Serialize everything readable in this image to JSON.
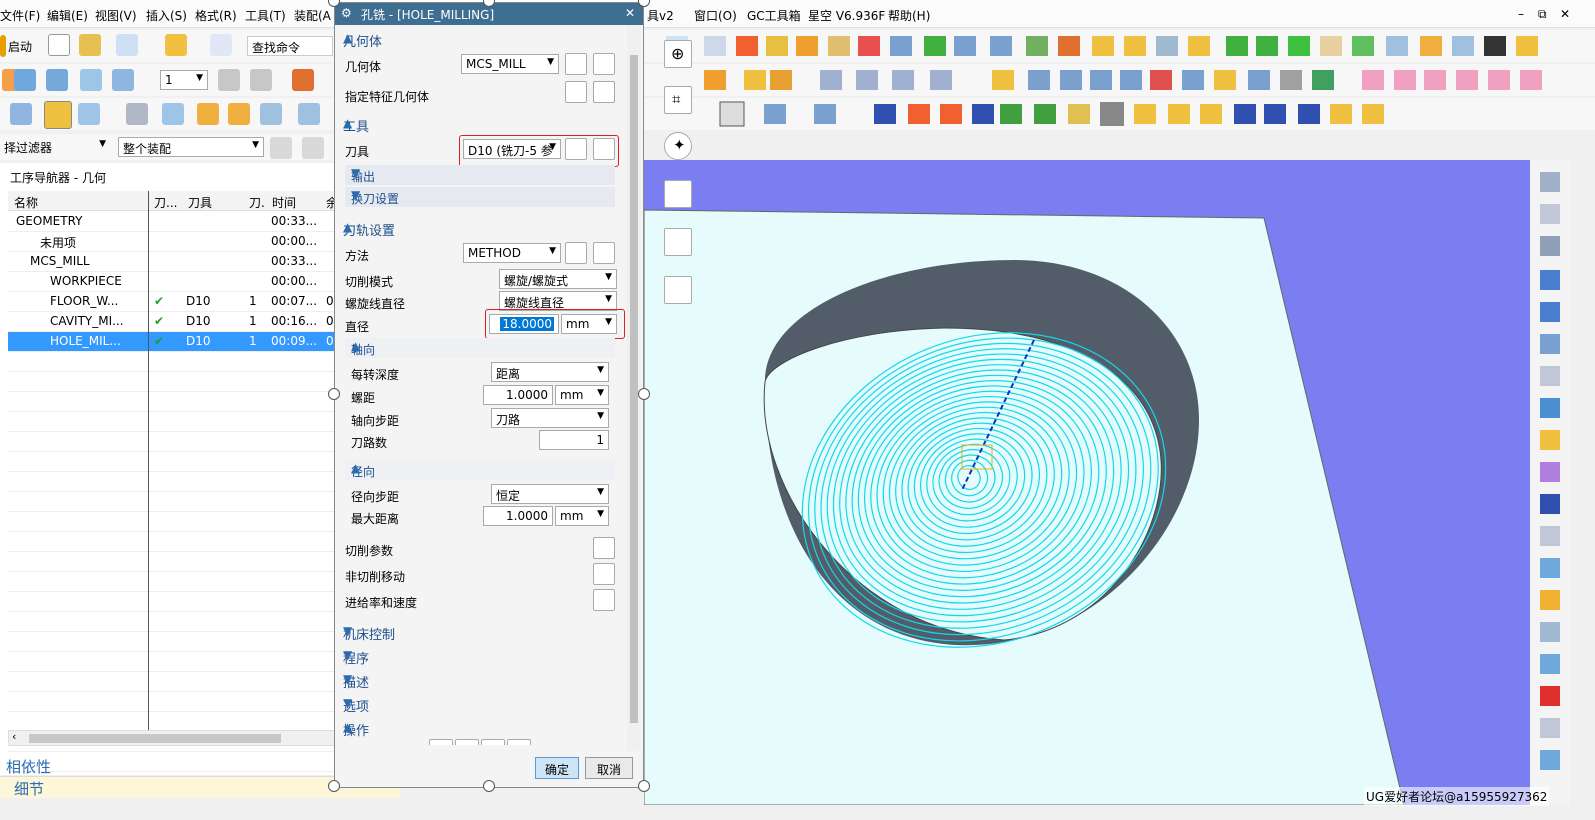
{
  "menubar": {
    "items_left": [
      "文件(F)",
      "编辑(E)",
      "视图(V)",
      "插入(S)",
      "格式(R)",
      "工具(T)",
      "装配(A"
    ],
    "items_right": [
      "具v2",
      "窗口(O)",
      "GC工具箱",
      "星空 V6.936F",
      "帮助(H)"
    ]
  },
  "toolbar": {
    "start_label": "启动",
    "layer_value": "1",
    "search_placeholder": "查找命令",
    "filter_value": "择过滤器",
    "assembly_value": "整个装配"
  },
  "navigator": {
    "title": "工序导航器 - 几何",
    "columns": [
      "名称",
      "刀...",
      "刀具",
      "刀.",
      "时间",
      "余"
    ],
    "rows": [
      {
        "name": "GEOMETRY",
        "check": "",
        "tool": "",
        "num": "",
        "time": "00:33...",
        "extra": ""
      },
      {
        "name": "未用项",
        "check": "",
        "tool": "",
        "num": "",
        "time": "00:00...",
        "extra": ""
      },
      {
        "name": "MCS_MILL",
        "check": "",
        "tool": "",
        "num": "",
        "time": "00:33...",
        "extra": ""
      },
      {
        "name": "WORKPIECE",
        "check": "",
        "tool": "",
        "num": "",
        "time": "00:00...",
        "extra": ""
      },
      {
        "name": "FLOOR_W...",
        "check": "✔",
        "tool": "D10",
        "num": "1",
        "time": "00:07...",
        "extra": "0"
      },
      {
        "name": "CAVITY_MI...",
        "check": "✔",
        "tool": "D10",
        "num": "1",
        "time": "00:16...",
        "extra": "0"
      },
      {
        "name": "HOLE_MIL...",
        "check": "✔",
        "tool": "D10",
        "num": "1",
        "time": "00:09...",
        "extra": "0"
      }
    ]
  },
  "bottom_panels": [
    "相依性",
    "细节"
  ],
  "dialog": {
    "title": "孔铣 - [HOLE_MILLING]",
    "close": "✕",
    "sec_geometry": "几何体",
    "geometry_label": "几何体",
    "geometry_value": "MCS_MILL",
    "feature_geometry_label": "指定特征几何体",
    "sec_tool": "工具",
    "tool_label": "刀具",
    "tool_value": "D10 (铣刀-5 参",
    "output_label": "输出",
    "toolchange_label": "换刀设置",
    "sec_path": "刀轨设置",
    "method_label": "方法",
    "method_value": "METHOD",
    "cut_mode_label": "切削模式",
    "cut_mode_value": "螺旋/螺旋式",
    "helix_diameter_label": "螺旋线直径",
    "helix_diameter_value": "螺旋线直径",
    "diameter_label": "直径",
    "diameter_value": "18.0000",
    "diameter_unit": "mm",
    "axial_label": "轴向",
    "depth_per_rev_label": "每转深度",
    "depth_per_rev_value": "距离",
    "pitch_label": "螺距",
    "pitch_value": "1.0000",
    "pitch_unit": "mm",
    "axial_step_label": "轴向步距",
    "axial_step_value": "刀路",
    "passes_label": "刀路数",
    "passes_value": "1",
    "radial_label": "径向",
    "radial_step_label": "径向步距",
    "radial_step_value": "恒定",
    "max_dist_label": "最大距离",
    "max_dist_value": "1.0000",
    "max_dist_unit": "mm",
    "cut_params_label": "切削参数",
    "noncut_label": "非切削移动",
    "feeds_label": "进给率和速度",
    "sec_machine": "机床控制",
    "sec_program": "程序",
    "sec_desc": "描述",
    "sec_options": "选项",
    "sec_ops": "操作",
    "ok_label": "确定",
    "cancel_label": "取消"
  },
  "watermark": "UG爱好者论坛@a15955927362",
  "colors": {
    "accent": "#3399ff",
    "title_bar": "#3e6f92",
    "viewport_bg": "#7b7ef0",
    "part_face": "#e6fbfc",
    "toolpath": "#12d8ec"
  }
}
